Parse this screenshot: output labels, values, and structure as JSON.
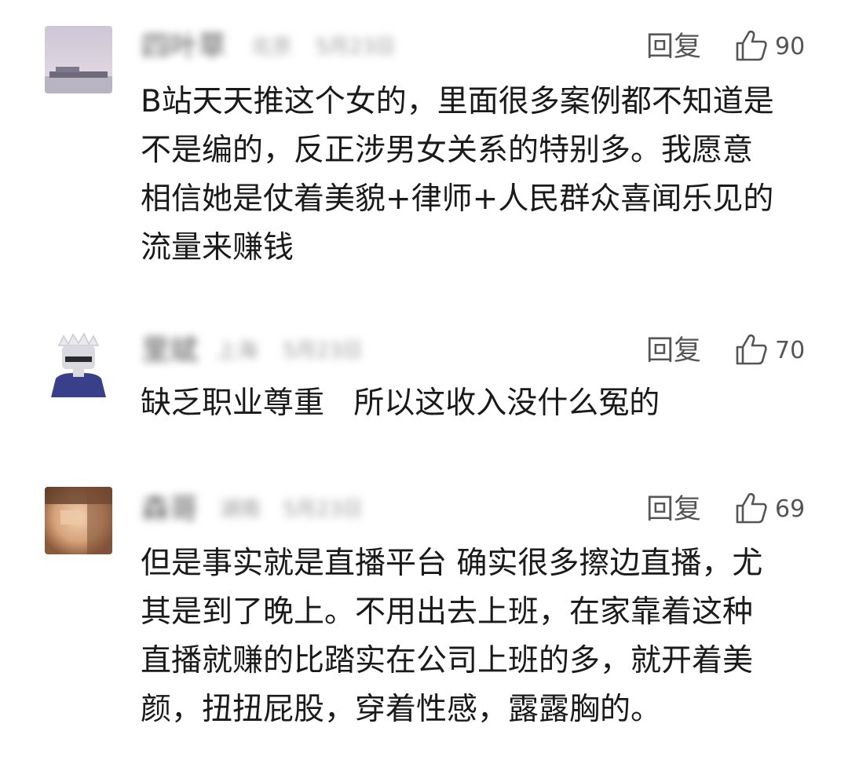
{
  "comments": [
    {
      "author": "四叶草",
      "location": "北京",
      "time": "5月23日",
      "reply_label": "回复",
      "likes": "90",
      "text": "B站天天推这个女的，里面很多案例都不知道是\n不是编的，反正涉男女关系的特别多。我愿意\n相信她是仗着美貌+律师+人民群众喜闻乐见的\n流量来赚钱",
      "avatar_icon": "landscape-avatar"
    },
    {
      "author": "里斌",
      "location": "上海",
      "time": "5月23日",
      "reply_label": "回复",
      "likes": "70",
      "text": "缺乏职业尊重   所以这收入没什么冤的",
      "avatar_icon": "cartoon-character-avatar"
    },
    {
      "author": "森哥",
      "location": "湖南",
      "time": "5月23日",
      "reply_label": "回复",
      "likes": "69",
      "text": "但是事实就是直播平台 确实很多擦边直播，尤\n其是到了晚上。不用出去上班，在家靠着这种\n直播就赚的比踏实在公司上班的多，就开着美\n颜，扭扭屁股，穿着性感，露露胸的。",
      "avatar_icon": "blurred-photo-avatar"
    }
  ],
  "colors": {
    "text": "#1a1a1a",
    "secondary": "#555555",
    "meta": "#9a9a9a",
    "background": "#ffffff"
  }
}
